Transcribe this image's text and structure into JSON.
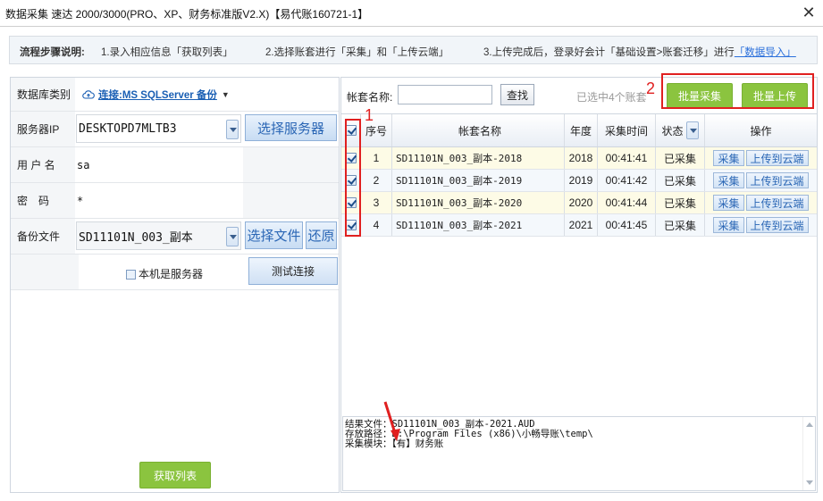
{
  "window": {
    "title": "数据采集 速达 2000/3000(PRO、XP、财务标准版V2.X)【易代账160721-1】",
    "close_label": "✕"
  },
  "steps": {
    "lead": "流程步骤说明:",
    "step1": "1.录入相应信息「获取列表」",
    "step2": "2.选择账套进行「采集」和「上传云端」",
    "step3": "3.上传完成后，登录好会计「基础设置>账套迁移」进行",
    "link": "「数据导入」"
  },
  "form": {
    "dbtype_label": "数据库类别",
    "dbtype_value": "连接:MS SQLServer 备份",
    "server_label": "服务器IP",
    "server_value": "DESKTOPD7MLTB3",
    "select_server": "选择服务器",
    "user_label": "用 户 名",
    "user_value": "sa",
    "pwd_label": "密　码",
    "pwd_value": "*",
    "backup_label": "备份文件",
    "backup_value": "SD11101N_003_副本",
    "select_file": "选择文件",
    "restore": "还原",
    "local_server": "本机是服务器",
    "test_conn": "测试连接",
    "get_list": "获取列表"
  },
  "toolbar": {
    "name_label": "帐套名称:",
    "name_value": "",
    "search": "查找",
    "selected_info": "已选中4个账套",
    "batch_collect": "批量采集",
    "batch_upload": "批量上传"
  },
  "annotations": {
    "n1": "1",
    "n2": "2"
  },
  "table": {
    "headers": {
      "seq": "序号",
      "name": "帐套名称",
      "year": "年度",
      "time": "采集时间",
      "status": "状态",
      "action": "操作"
    },
    "rows": [
      {
        "seq": "1",
        "name": "SD11101N_003_副本-2018",
        "year": "2018",
        "time": "00:41:41",
        "status": "已采集",
        "collect": "采集",
        "upload": "上传到云端"
      },
      {
        "seq": "2",
        "name": "SD11101N_003_副本-2019",
        "year": "2019",
        "time": "00:41:42",
        "status": "已采集",
        "collect": "采集",
        "upload": "上传到云端"
      },
      {
        "seq": "3",
        "name": "SD11101N_003_副本-2020",
        "year": "2020",
        "time": "00:41:44",
        "status": "已采集",
        "collect": "采集",
        "upload": "上传到云端"
      },
      {
        "seq": "4",
        "name": "SD11101N_003_副本-2021",
        "year": "2021",
        "time": "00:41:45",
        "status": "已采集",
        "collect": "采集",
        "upload": "上传到云端"
      }
    ]
  },
  "log": {
    "line1": "结果文件：SD11101N_003_副本-2021.AUD",
    "line2": "存放路径：D:\\Program Files (x86)\\小畅导账\\temp\\",
    "line3": "采集模块：【有】财务账"
  },
  "colors": {
    "accent_green": "#8bc43f",
    "annotation_red": "#e02020",
    "link_blue": "#2a66b5"
  }
}
